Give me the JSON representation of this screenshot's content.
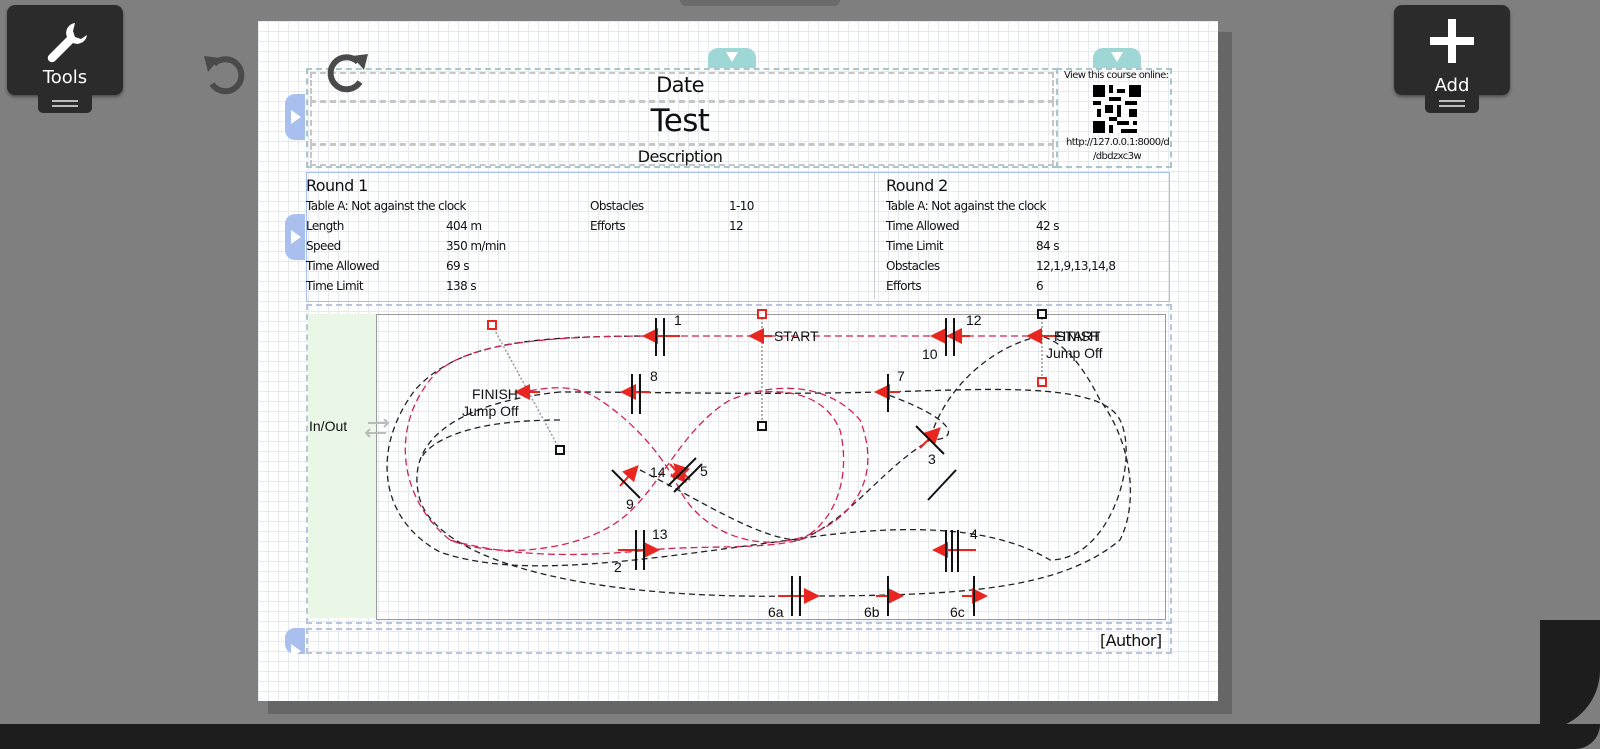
{
  "toolbar": {
    "tools_label": "Tools",
    "add_label": "Add"
  },
  "header": {
    "date": "Date",
    "title": "Test",
    "description": "Description",
    "online_label": "View this course online:",
    "url_line1": "http://127.0.0.1:8000/d",
    "url_line2": "/dbdzxc3w"
  },
  "round1": {
    "heading": "Round 1",
    "table": "Table A: Not against the clock",
    "rows": [
      {
        "label": "Length",
        "value": "404 m"
      },
      {
        "label": "Speed",
        "value": "350 m/min"
      },
      {
        "label": "Time Allowed",
        "value": "69 s"
      },
      {
        "label": "Time Limit",
        "value": "138 s"
      }
    ],
    "obstacles_label": "Obstacles",
    "obstacles_value": "1-10",
    "efforts_label": "Efforts",
    "efforts_value": "12"
  },
  "round2": {
    "heading": "Round 2",
    "table": "Table A: Not against the clock",
    "rows": [
      {
        "label": "Time Allowed",
        "value": "42 s"
      },
      {
        "label": "Time Limit",
        "value": "84 s"
      },
      {
        "label": "Obstacles",
        "value": "12,1,9,13,14,8"
      },
      {
        "label": "Efforts",
        "value": "6"
      }
    ]
  },
  "course": {
    "in_out": "In/Out",
    "start_label": "START",
    "start_overlap_label": "START",
    "finish_label": "FINISH",
    "finish_overlap_label": "FINISH",
    "jump_off_label": "Jump Off",
    "obstacles": {
      "o1": "1",
      "o2": "2",
      "o3": "3",
      "o4": "4",
      "o5": "5",
      "o6a": "6a",
      "o6b": "6b",
      "o6c": "6c",
      "o7": "7",
      "o8": "8",
      "o9": "9",
      "o10": "10",
      "o12": "12",
      "o13": "13",
      "o14": "14"
    }
  },
  "footer": {
    "author": "[Author]"
  },
  "colors": {
    "route_round1": "#222222",
    "route_jumpoff": "#d12352",
    "arrow": "#e8261f",
    "side_tab": "#a9c0ef",
    "top_tab": "#9fd6d6"
  }
}
